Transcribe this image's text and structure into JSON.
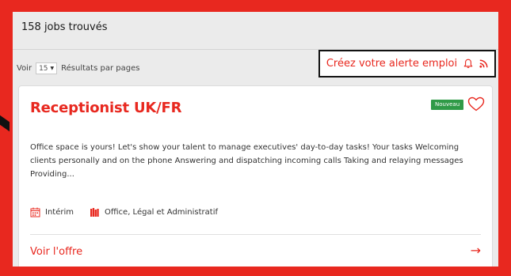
{
  "results": {
    "count_label": "158 jobs trouvés"
  },
  "pagination": {
    "prefix": "Voir",
    "per_page_value": "15",
    "suffix": "Résultats par pages"
  },
  "alert": {
    "label": "Créez votre alerte emploi",
    "icons": [
      "bell-icon",
      "rss-icon"
    ]
  },
  "job": {
    "title": "Receptionist UK/FR",
    "badge": "Nouveau",
    "description": "Office space is yours! Let's show your talent to manage executives'  day-to-day tasks! Your tasks Welcoming clients personally and on the phone Answering and dispatching incoming calls Taking and relaying messages Providing...",
    "contract_type": "Intérim",
    "category": "Office, Légal et Administratif",
    "cta": "Voir l'offre",
    "cta_arrow": "→"
  },
  "colors": {
    "accent": "#e8281f",
    "badge": "#2f9a47",
    "panel_bg": "#ebebeb"
  }
}
